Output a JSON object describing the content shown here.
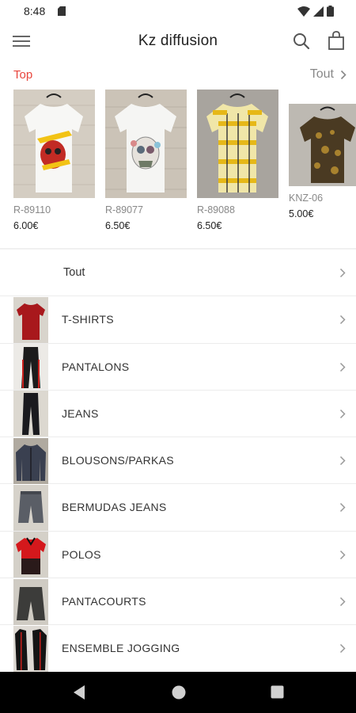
{
  "status_bar": {
    "time": "8:48",
    "icons": [
      "sd-card-icon",
      "wifi-icon",
      "signal-icon",
      "battery-icon"
    ]
  },
  "app_bar": {
    "title": "Kz diffusion",
    "icons": [
      "menu-icon",
      "search-icon",
      "shopping-bag-icon"
    ]
  },
  "top_section": {
    "label": "Top",
    "all_label": "Tout",
    "products": [
      {
        "sku": "R-89110",
        "price": "6.00€"
      },
      {
        "sku": "R-89077",
        "price": "6.50€"
      },
      {
        "sku": "R-89088",
        "price": "6.50€"
      },
      {
        "sku": "KNZ-06",
        "price": "5.00€"
      }
    ]
  },
  "categories": [
    {
      "label": "Tout"
    },
    {
      "label": "T-SHIRTS"
    },
    {
      "label": "PANTALONS"
    },
    {
      "label": "JEANS"
    },
    {
      "label": "BLOUSONS/PARKAS"
    },
    {
      "label": "BERMUDAS JEANS"
    },
    {
      "label": "POLOS"
    },
    {
      "label": "PANTACOURTS"
    },
    {
      "label": "ENSEMBLE JOGGING"
    }
  ],
  "nav_bar": {
    "icons": [
      "back-icon",
      "home-icon",
      "recent-apps-icon"
    ]
  },
  "colors": {
    "accent": "#e8453c",
    "muted_text": "#888888",
    "nav_bar": "#000000"
  }
}
